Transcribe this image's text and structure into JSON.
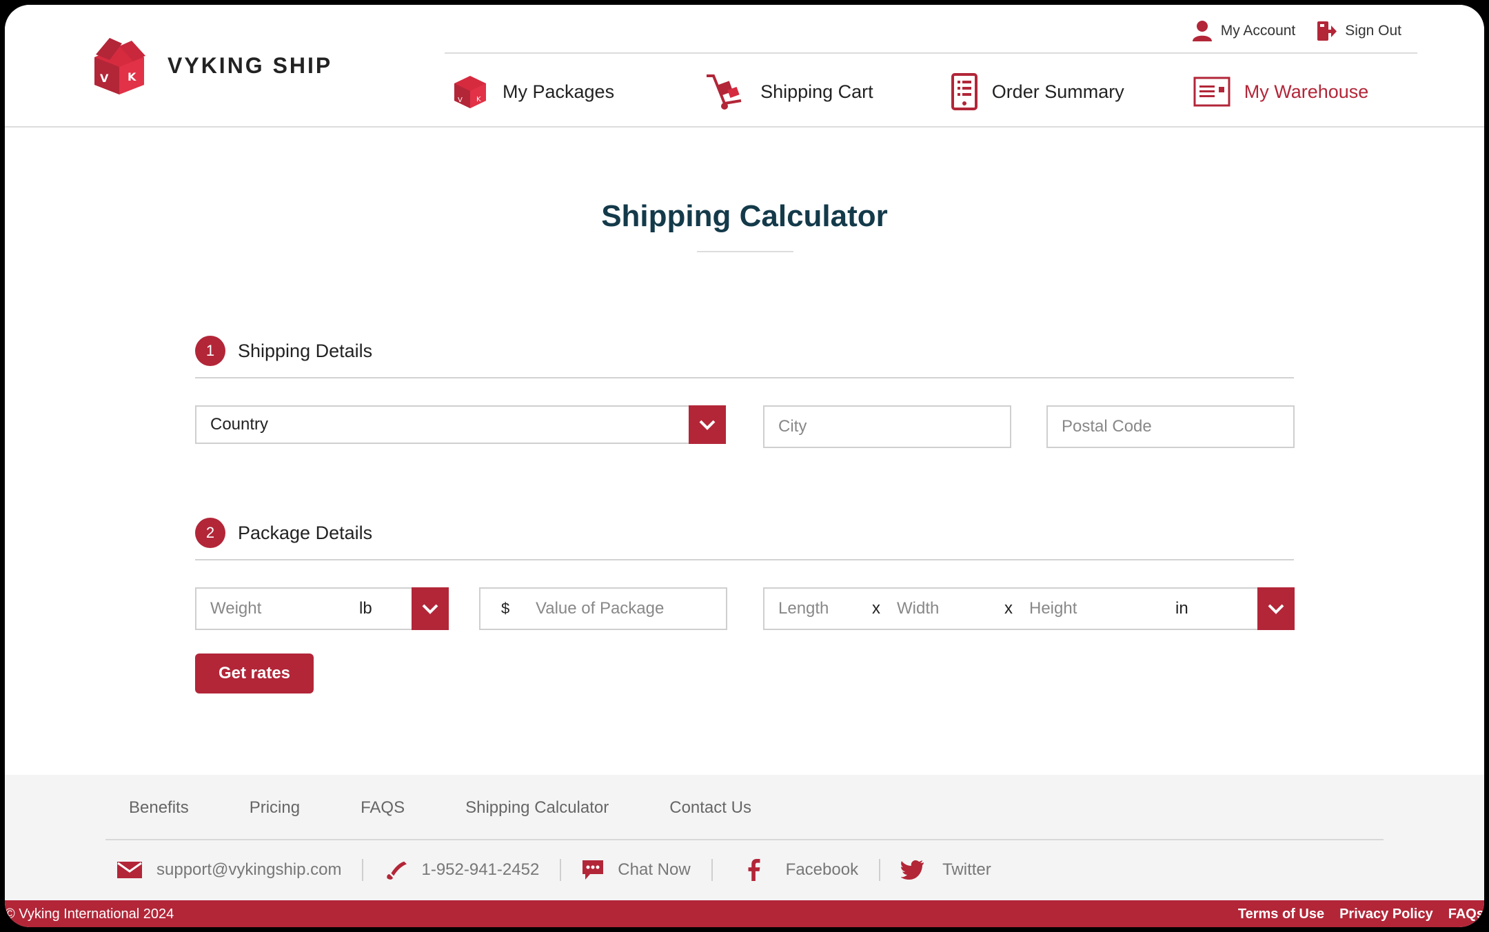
{
  "brand": {
    "name": "VYKING SHIP",
    "accent": "#b22638",
    "dark_text": "#143a4a"
  },
  "account_bar": [
    {
      "label": "My Account",
      "icon": "user-icon"
    },
    {
      "label": "Sign Out",
      "icon": "sign-out-icon"
    }
  ],
  "nav": [
    {
      "label": "My Packages",
      "icon": "package-icon",
      "active": false
    },
    {
      "label": "Shipping Cart",
      "icon": "hand-truck-icon",
      "active": false
    },
    {
      "label": "Order Summary",
      "icon": "order-list-icon",
      "active": false
    },
    {
      "label": "My Warehouse",
      "icon": "warehouse-icon",
      "active": true
    }
  ],
  "page": {
    "title": "Shipping Calculator"
  },
  "shipping_details": {
    "step": "1",
    "label": "Shipping Details",
    "country": {
      "value": "Country"
    },
    "city": {
      "placeholder": "City"
    },
    "postal": {
      "placeholder": "Postal Code"
    }
  },
  "package_details": {
    "step": "2",
    "label": "Package Details",
    "weight": {
      "placeholder": "Weight",
      "unit": "lb"
    },
    "value": {
      "currency": "$",
      "placeholder": "Value of Package"
    },
    "dimensions": {
      "length": "Length",
      "width": "Width",
      "height": "Height",
      "sep": "x",
      "unit": "in"
    }
  },
  "actions": {
    "get_rates": "Get rates"
  },
  "footer": {
    "links": [
      "Benefits",
      "Pricing",
      "FAQS",
      "Shipping Calculator",
      "Contact Us"
    ],
    "contacts": [
      {
        "label": "support@vykingship.com",
        "icon": "mail-icon"
      },
      {
        "label": "1-952-941-2452",
        "icon": "phone-icon"
      },
      {
        "label": "Chat Now",
        "icon": "chat-icon"
      },
      {
        "label": "Facebook",
        "icon": "facebook-icon"
      },
      {
        "label": "Twitter",
        "icon": "twitter-icon"
      }
    ],
    "copyright": "© Vyking International 2024",
    "legal": [
      "Terms of Use",
      "Privacy Policy",
      "FAQs"
    ]
  }
}
